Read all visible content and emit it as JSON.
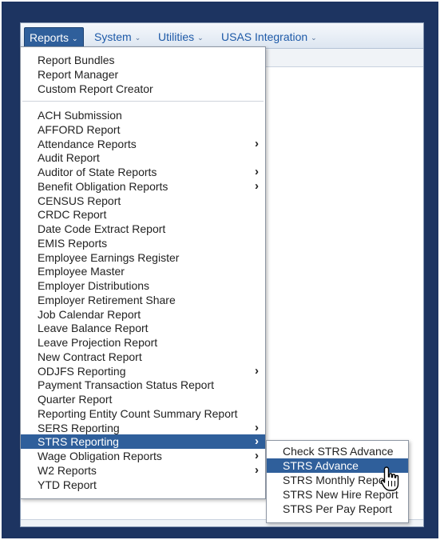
{
  "menubar": {
    "items": [
      {
        "label": "Reports",
        "active": true
      },
      {
        "label": "System"
      },
      {
        "label": "Utilities"
      },
      {
        "label": "USAS Integration"
      }
    ],
    "caret": "⌄"
  },
  "reports_menu": {
    "group1": [
      {
        "label": "Report Bundles"
      },
      {
        "label": "Report Manager"
      },
      {
        "label": "Custom Report Creator"
      }
    ],
    "group2": [
      {
        "label": "ACH Submission"
      },
      {
        "label": "AFFORD Report"
      },
      {
        "label": "Attendance Reports",
        "submenu": true
      },
      {
        "label": "Audit Report"
      },
      {
        "label": "Auditor of State Reports",
        "submenu": true
      },
      {
        "label": "Benefit Obligation Reports",
        "submenu": true
      },
      {
        "label": "CENSUS Report"
      },
      {
        "label": "CRDC Report"
      },
      {
        "label": "Date Code Extract Report"
      },
      {
        "label": "EMIS Reports"
      },
      {
        "label": "Employee Earnings Register"
      },
      {
        "label": "Employee Master"
      },
      {
        "label": "Employer Distributions"
      },
      {
        "label": "Employer Retirement Share"
      },
      {
        "label": "Job Calendar Report"
      },
      {
        "label": "Leave Balance Report"
      },
      {
        "label": "Leave Projection Report"
      },
      {
        "label": "New Contract Report"
      },
      {
        "label": "ODJFS Reporting",
        "submenu": true
      },
      {
        "label": "Payment Transaction Status Report"
      },
      {
        "label": "Quarter Report"
      },
      {
        "label": "Reporting Entity Count Summary Report"
      },
      {
        "label": "SERS Reporting",
        "submenu": true
      },
      {
        "label": "STRS Reporting",
        "submenu": true,
        "highlighted": true
      },
      {
        "label": "Wage Obligation Reports",
        "submenu": true
      },
      {
        "label": "W2 Reports",
        "submenu": true
      },
      {
        "label": "YTD Report"
      }
    ],
    "arrow": "›"
  },
  "strs_submenu": {
    "items": [
      {
        "label": "Check STRS Advance"
      },
      {
        "label": "STRS Advance",
        "highlighted": true
      },
      {
        "label": "STRS Monthly Report"
      },
      {
        "label": "STRS New Hire Report"
      },
      {
        "label": "STRS Per Pay Report"
      }
    ]
  },
  "colors": {
    "frame": "#1d3461",
    "highlight": "#2f5f9b",
    "menu_link": "#1e5aa8"
  },
  "icons": {
    "cursor": "hand-pointer-icon",
    "submenu_arrow": "chevron-right-icon",
    "menu_caret": "chevron-down-icon"
  }
}
